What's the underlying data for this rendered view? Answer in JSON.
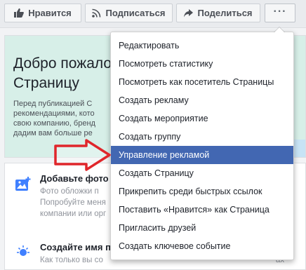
{
  "toolbar": {
    "like_label": "Нравится",
    "follow_label": "Подписаться",
    "share_label": "Поделиться",
    "more_label": "···"
  },
  "background": {
    "welcome_title": "Добро пожалов\nСтраницу",
    "welcome_text": "Перед публикацией С\nрекомендациями, кото\nсвою компанию, бренд\nдадим вам больше ре",
    "tasks": [
      {
        "title": "Добавьте фото о",
        "desc": "Фото обложки п                                                                        ей\nПопробуйте меня\nкомпании или орг"
      },
      {
        "title": "Создайте имя п",
        "desc": "Как только вы со                                                                             ах"
      }
    ]
  },
  "menu": {
    "items": [
      "Редактировать",
      "Посмотреть статистику",
      "Посмотреть как посетитель Страницы",
      "Создать рекламу",
      "Создать мероприятие",
      "Создать группу",
      "Управление рекламой",
      "Создать Страницу",
      "Прикрепить среди быстрых ссылок",
      "Поставить «Нравится» как Страница",
      "Пригласить друзей",
      "Создать ключевое событие"
    ],
    "highlighted_index": 6
  },
  "colors": {
    "accent": "#4267b2",
    "annotation_arrow": "#e0262b",
    "welcome_bg": "#d7efe8"
  }
}
